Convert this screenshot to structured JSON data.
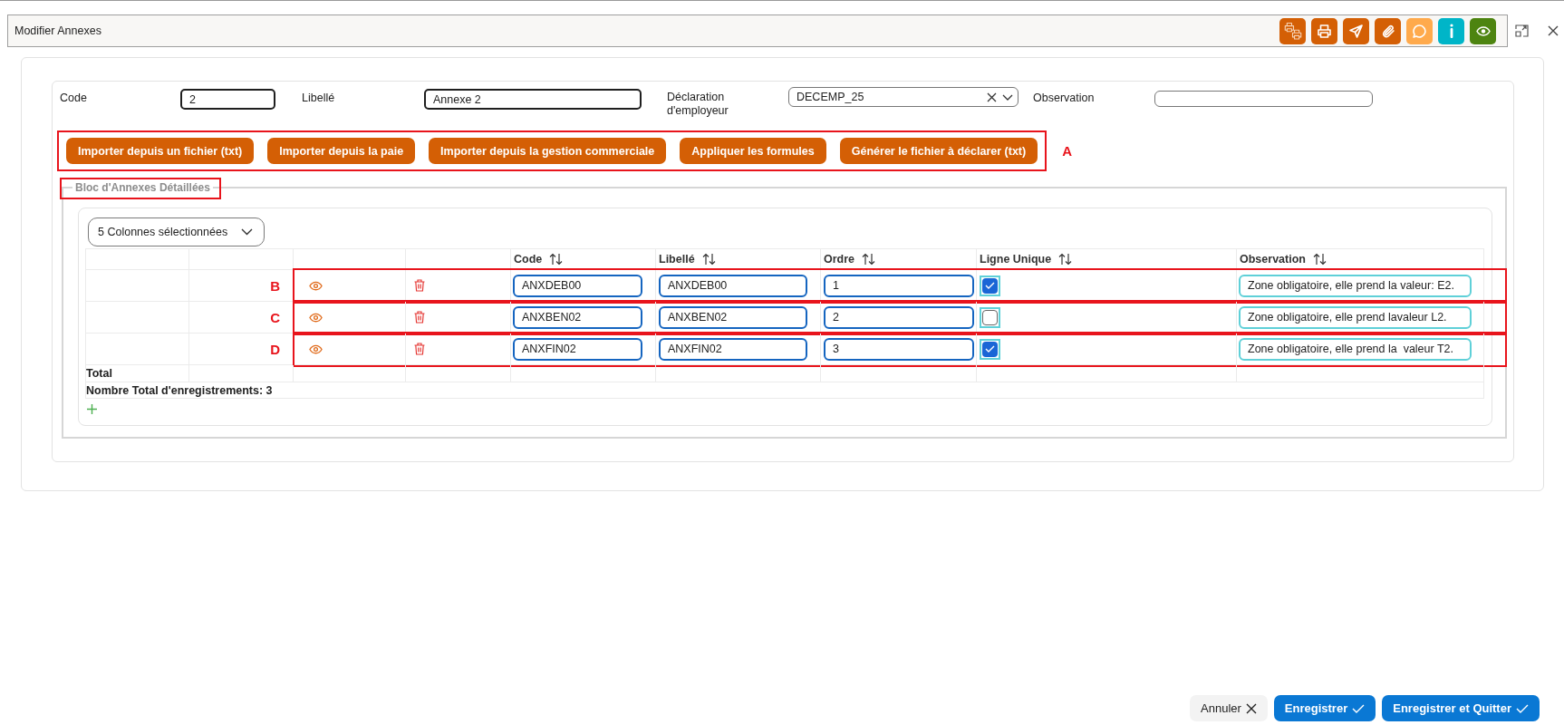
{
  "window": {
    "title": "Modifier Annexes"
  },
  "toolbar": [
    {
      "kind": "batch-print",
      "color": "#d45f05"
    },
    {
      "kind": "print",
      "color": "#d45f05"
    },
    {
      "kind": "send",
      "color": "#d45f05"
    },
    {
      "kind": "attach",
      "color": "#d45f05"
    },
    {
      "kind": "comment",
      "color": "#ffaa4c"
    },
    {
      "kind": "info",
      "color": "#00b5c8"
    },
    {
      "kind": "view",
      "color": "#4d8410"
    }
  ],
  "form": {
    "fields": [
      {
        "kind": "text",
        "label": "Code",
        "value": "2",
        "required": true
      },
      {
        "kind": "text",
        "label": "Libellé",
        "value": "Annexe 2",
        "required": true
      },
      {
        "kind": "select",
        "label": "Déclaration d'employeur",
        "value": "DECEMP_25"
      },
      {
        "kind": "text",
        "label": "Observation",
        "required": false
      }
    ]
  },
  "actions": {
    "annotation_box": true,
    "annotation_label": "A",
    "buttons": [
      "Importer depuis un fichier (txt)",
      "Importer depuis la paie",
      "Importer depuis la gestion commerciale",
      "Appliquer les formules",
      "Générer le fichier à déclarer (txt)"
    ]
  },
  "section": {
    "legend": "Bloc d'Annexes Détaillées",
    "annotation_box": true,
    "column_picker": "5 Colonnes sélectionnées",
    "table": {
      "columns": [
        {
          "label": "Code",
          "sortable": true
        },
        {
          "label": "Libellé",
          "sortable": true
        },
        {
          "label": "Ordre",
          "sortable": true
        },
        {
          "label": "Ligne Unique",
          "sortable": true
        },
        {
          "label": "Observation",
          "sortable": true
        }
      ],
      "rows": [
        {
          "annotation_box": true,
          "annotation_label": "B",
          "code": "ANXDEB00",
          "libelle": "ANXDEB00",
          "ordre": "1",
          "ligne_unique": true,
          "observation": "Zone obligatoire, elle prend la valeur: E2."
        },
        {
          "annotation_box": true,
          "annotation_label": "C",
          "code": "ANXBEN02",
          "libelle": "ANXBEN02",
          "ordre": "2",
          "ligne_unique": false,
          "observation": "Zone obligatoire, elle prend lavaleur L2."
        },
        {
          "annotation_box": true,
          "annotation_label": "D",
          "code": "ANXFIN02",
          "libelle": "ANXFIN02",
          "ordre": "3",
          "ligne_unique": true,
          "observation": "Zone obligatoire, elle prend la  valeur T2."
        }
      ],
      "total_label": "Total",
      "record_count": "Nombre Total d'enregistrements: 3"
    }
  },
  "footer": {
    "buttons": [
      {
        "kind": "cancel",
        "label": "Annuler"
      },
      {
        "kind": "confirm",
        "label": "Enregistrer"
      },
      {
        "kind": "confirm",
        "label": "Enregistrer et Quitter"
      }
    ]
  }
}
